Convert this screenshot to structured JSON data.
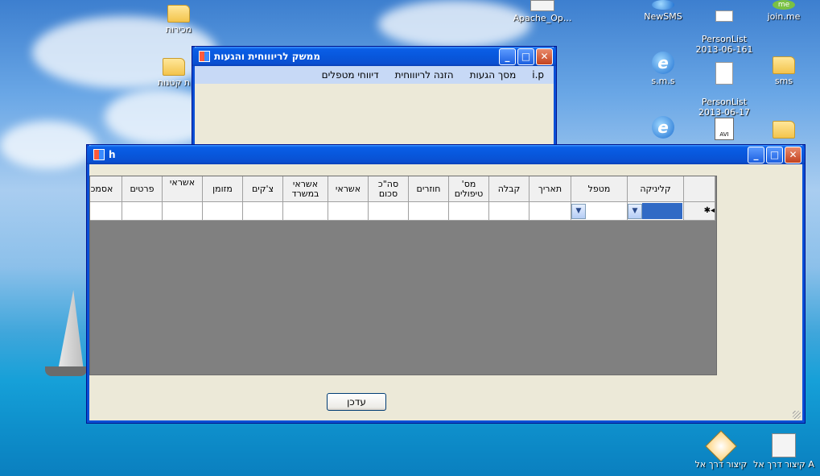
{
  "desktop": {
    "icons": [
      {
        "label": "מכירות",
        "kind": "folder"
      },
      {
        "label": "ת קטנות",
        "kind": "folder"
      },
      {
        "label": "Apache_Op...",
        "kind": "shortcut"
      },
      {
        "label": "NewSMS",
        "kind": "ie"
      },
      {
        "label": "PersonList\n2013-06-161",
        "kind": "doc"
      },
      {
        "label": "join.me",
        "kind": "me"
      },
      {
        "label": "s.m.s",
        "kind": "ie"
      },
      {
        "label": "PersonList\n2013-06-17",
        "kind": "doc"
      },
      {
        "label": "sms",
        "kind": "folder"
      },
      {
        "label": "",
        "kind": "ie"
      },
      {
        "label": "",
        "kind": "avi"
      },
      {
        "label": "",
        "kind": "folder"
      },
      {
        "label": "קיצור דרך אל",
        "kind": "gif"
      },
      {
        "label": "קיצור דרך אל A",
        "kind": "shortcut"
      }
    ]
  },
  "back_window": {
    "title": "ממשק לריוווחית והגעות",
    "menu": [
      "i.p",
      "מסך הגעות",
      "הזנה לריוווחית",
      "דיווחי מטפלים"
    ]
  },
  "front_window": {
    "title": "h",
    "columns": [
      "קליניקה",
      "מטפל",
      "תאריך",
      "קבלה",
      "מס' טיפולים",
      "חוזרים",
      "סה\"כ סכום",
      "אשראי",
      "אשראי במשרד",
      "צ'קים",
      "מזומן",
      "אשראי",
      "פרטים",
      "אסמכ"
    ],
    "new_row_marker": "✱",
    "update_button": "עדכן"
  },
  "colors": {
    "titlebar": "#0a5ee6",
    "window_bg": "#ece9d8",
    "grid_bg": "#808080",
    "selected_cell": "#316ac5"
  }
}
